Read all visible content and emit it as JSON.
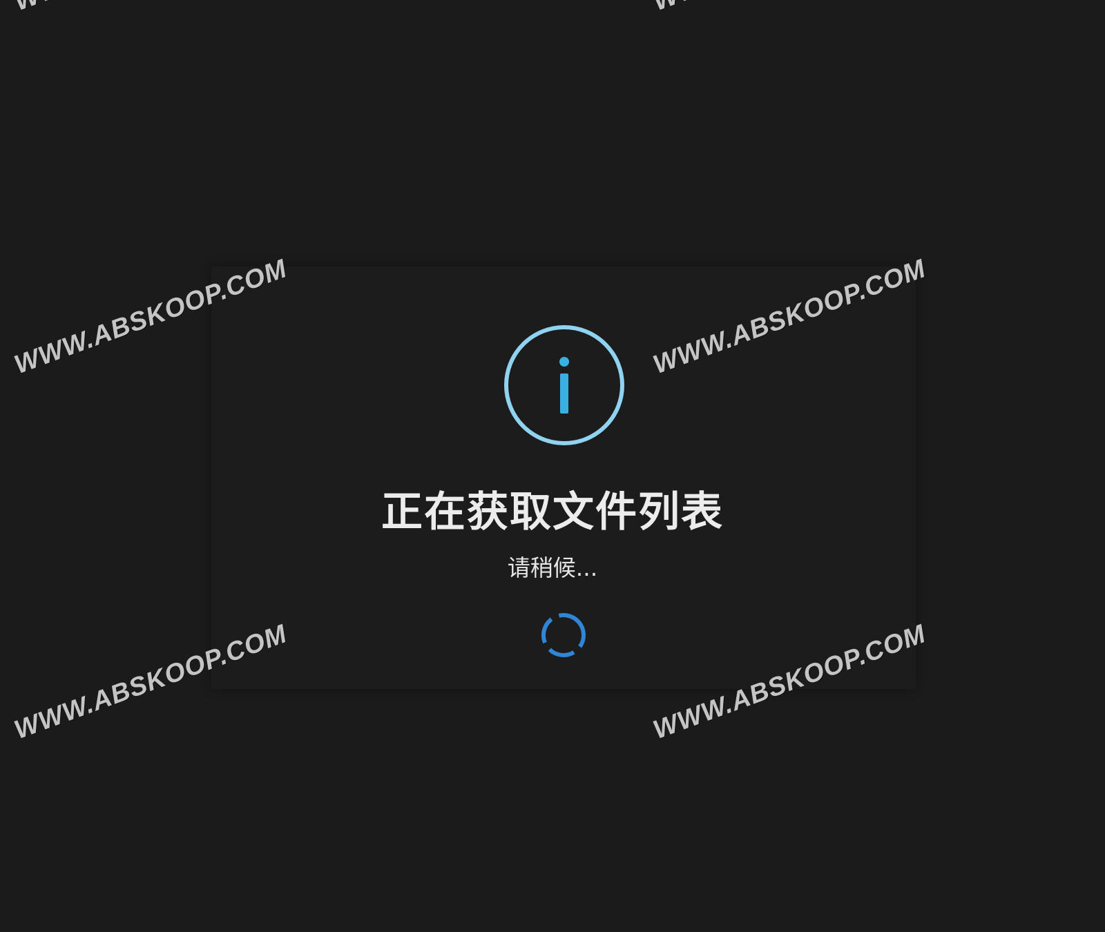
{
  "dialog": {
    "icon": "info-icon",
    "title": "正在获取文件列表",
    "subtitle": "请稍候...",
    "spinner": "loading-spinner-icon"
  },
  "colors": {
    "background": "#1b1b1c",
    "icon_ring": "#8fd3f0",
    "icon_glyph": "#3ab0e2",
    "spinner": "#2f86d6",
    "title": "#ececec"
  },
  "watermarks": [
    "WWW.ABSKOOP.COM",
    "WWW.ABSKOOP.COM",
    "WWW.ABSKOOP.COM",
    "WWW.ABSKOOP.COM",
    "WWW.ABSKOOP.COM",
    "WWW.ABSKOOP.COM"
  ]
}
